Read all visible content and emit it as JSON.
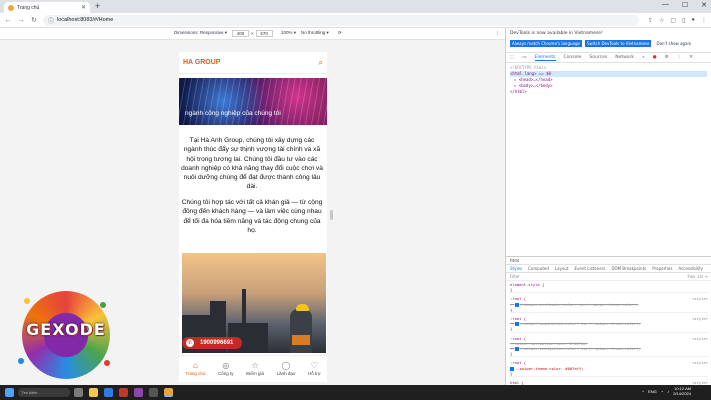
{
  "browser": {
    "tab_title": "Trang chủ",
    "url": "localhost:8083/#/Home"
  },
  "device_toolbar": {
    "dimensions_label": "Dimensions: Responsive ▾",
    "width": "400",
    "height": "670",
    "zoom": "100% ▾",
    "throttling": "No throttling ▾"
  },
  "site": {
    "brand": "HA GROUP",
    "banner_caption": "ngành công nghiệp của chúng tôi",
    "paragraph1": "Tại Hà Anh Group, chúng tôi xây dựng các ngành thúc đẩy sự thịnh vượng tài chính và xã hội trong tương lai. Chúng tôi đầu tư vào các doanh nghiệp có khả năng thay đổi cuộc chơi và nuôi dưỡng chúng để đạt được thành công lâu dài.",
    "paragraph2": "Chúng tôi hợp tác với tất cả khán giả — từ cộng đồng đến khách hàng — và làm việc cùng nhau để tối đa hóa tiềm năng và tác động chung của họ.",
    "hotline": "1900996691",
    "nav": [
      {
        "label": "Trang chủ",
        "icon": "home-icon"
      },
      {
        "label": "Công ty",
        "icon": "building-icon"
      },
      {
        "label": "Điểm giá",
        "icon": "star-icon"
      },
      {
        "label": "Lãnh đạo",
        "icon": "leader-icon"
      },
      {
        "label": "Hỗ trợ",
        "icon": "support-icon"
      }
    ]
  },
  "devtools": {
    "notice": "DevTools is now available in Vietnamese!",
    "btn_match": "Always match Chrome's language",
    "btn_switch": "Switch DevTools to Vietnamese",
    "btn_dismiss": "Don't show again",
    "tabs": [
      "Elements",
      "Console",
      "Sources",
      "Network",
      "»"
    ],
    "dom": [
      "<!DOCTYPE html>",
      "<html lang> == $0",
      "▸ <head>…</head>",
      "▸ <body>…</body>",
      "</html>"
    ],
    "crumb": "html",
    "sub_tabs": [
      "Styles",
      "Computed",
      "Layout",
      "Event Listeners",
      "DOM Breakpoints",
      "Properties",
      "Accessibility"
    ],
    "filter": "Filter",
    "filter_right": ":hov .cls +",
    "rules": [
      {
        "selector": "element.style {",
        "lines": [
          "}"
        ],
        "src": ""
      },
      {
        "selector": ":root {",
        "lines": [
          "--swiper-preloader-color: var(--swiper-theme-color);"
        ],
        "src": "<style>"
      },
      {
        "selector": ":root {",
        "lines": [
          "--swiper-pagination-color: var(--swiper-theme-color);"
        ],
        "src": "<style>"
      },
      {
        "selector": ":root {",
        "lines": [
          "--swiper-navigation-size: 0.067vw;",
          "--swiper-navigation-color: var(--swiper-theme-color);"
        ],
        "src": "<style>"
      },
      {
        "selector": ":root {",
        "lines": [
          "--swiper-theme-color: #007aff;"
        ],
        "src": "<style>"
      },
      {
        "selector": "html {",
        "lines": [],
        "src": "<style>"
      }
    ]
  },
  "logo": {
    "text": "GEXODE"
  },
  "taskbar": {
    "search": "Tìm kiếm",
    "lang": "ENG",
    "time": "10:12 AM",
    "date": "2/14/2024"
  },
  "colors": {
    "brand_orange": "#e05b1a",
    "hotline_red": "#c62828",
    "devtools_blue": "#1a73e8"
  }
}
